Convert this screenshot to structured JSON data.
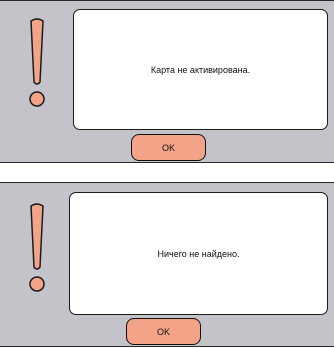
{
  "dialogs": [
    {
      "message": "Карта не активирована.",
      "button_label": "OK",
      "icon": "exclamation-icon"
    },
    {
      "message": "Ничего не найдено.",
      "button_label": "OK",
      "icon": "exclamation-icon"
    }
  ],
  "colors": {
    "panel_background": "#c3c3c9",
    "icon_fill": "#f3a488",
    "button_fill": "#f3a488",
    "message_background": "#ffffff"
  }
}
